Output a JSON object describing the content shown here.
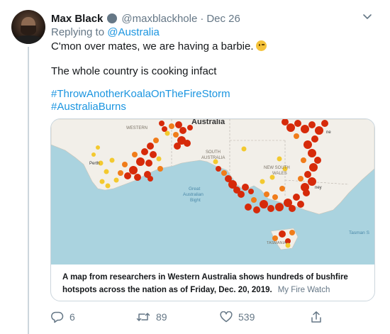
{
  "tweet": {
    "author_name": "Max Black",
    "handle": "@maxblackhole",
    "separator": "·",
    "date": "Dec 26",
    "replying_to_label": "Replying to",
    "replying_to_handle": "@Australia",
    "line1": "C'mon over mates, we are having a barbie.",
    "line2": "The whole country is cooking infact",
    "hashtag1": "#ThrowAnotherKoalaOnTheFireStorm",
    "hashtag2": "#AustraliaBurns"
  },
  "card": {
    "caption": "A map from researchers in Western Australia shows hundreds of bushfire hotspots across the nation as of Friday, Dec. 20, 2019.",
    "source": "My Fire Watch",
    "map_labels": {
      "country": "Australia",
      "west": "WESTERN",
      "south": "SOUTH",
      "south2": "AUSTRALIA",
      "nsw1": "NEW SOUTH",
      "nsw2": "WALES",
      "bight1": "Great",
      "bight2": "Australian",
      "bight3": "Bight",
      "tasman": "Tasman S",
      "tas": "TASMANIA",
      "perth": "Perth",
      "sydney": "ney",
      "brisbane": "ne"
    }
  },
  "actions": {
    "replies": "6",
    "retweets": "89",
    "likes": "539"
  },
  "colors": {
    "link": "#1b95e0",
    "muted": "#657786",
    "ocean": "#aad3df",
    "land": "#f2efe9",
    "fire_red": "#d62a0a",
    "fire_orange": "#f07c1a",
    "fire_yellow": "#f3c92f"
  }
}
